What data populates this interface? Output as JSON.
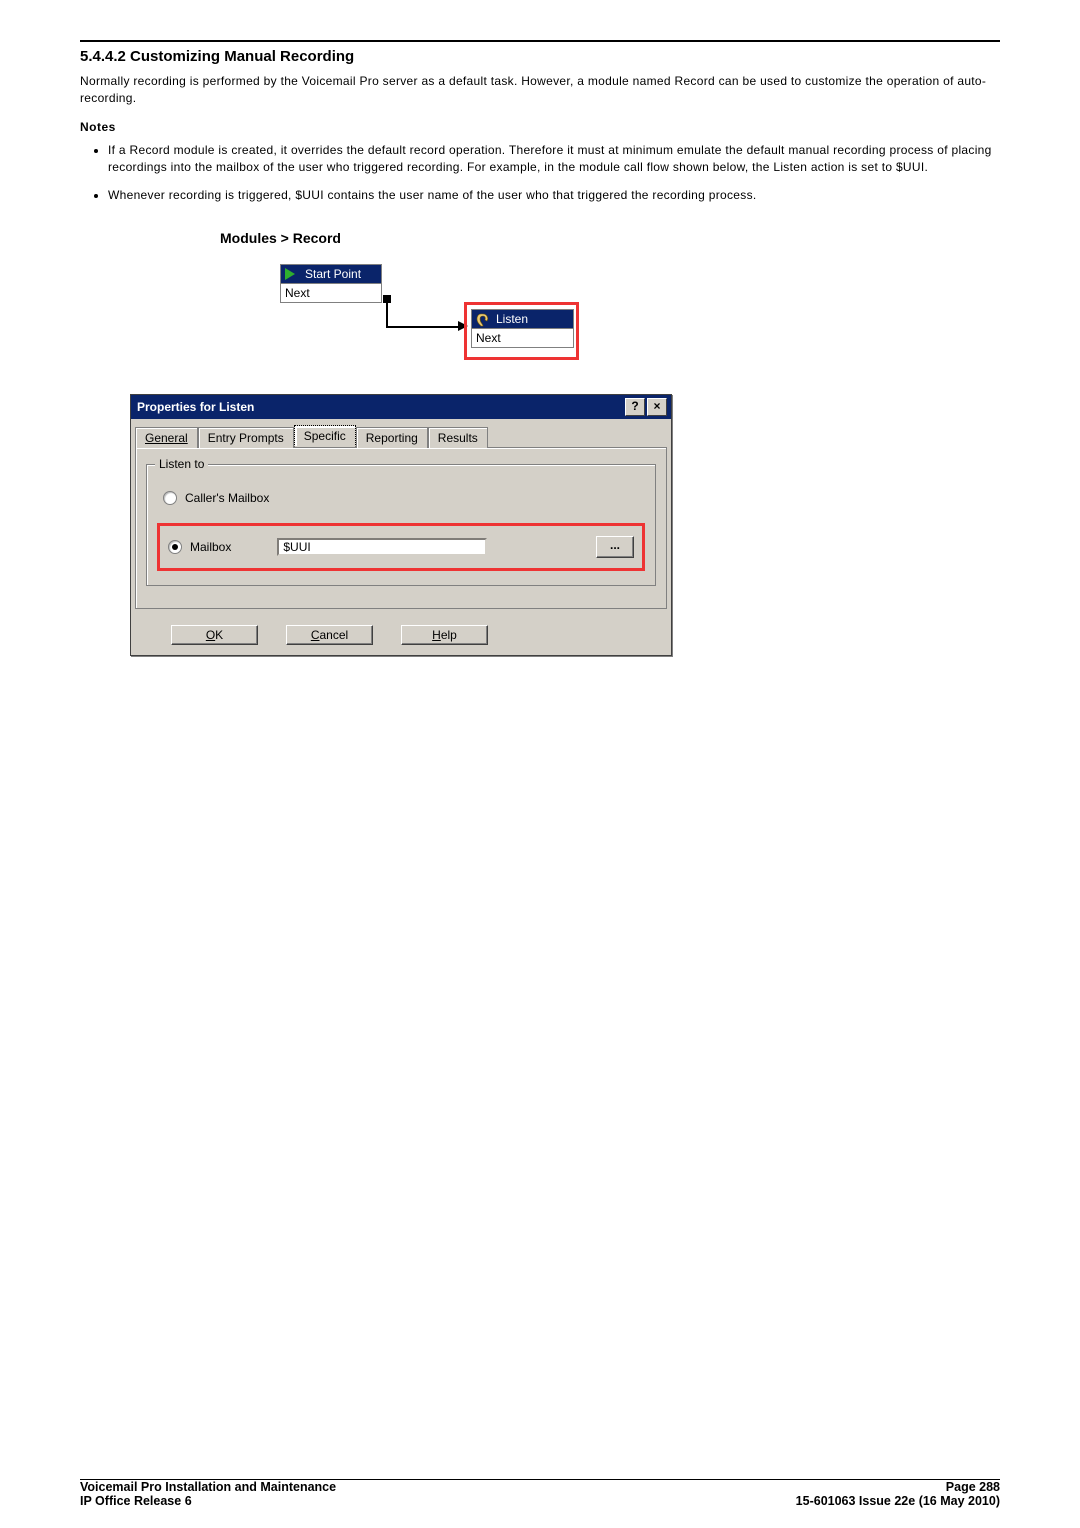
{
  "heading": "5.4.4.2 Customizing Manual Recording",
  "intro": "Normally recording is performed by the Voicemail Pro server as a default task. However, a module named Record can be used to customize the operation of auto-recording.",
  "notes_label": "Notes",
  "notes": [
    "If a Record module is created, it overrides the default record operation. Therefore it must at minimum emulate the default manual recording process of placing recordings into the mailbox of the user who triggered recording. For example, in the module call flow shown below, the Listen action is set to $UUI.",
    "Whenever recording is triggered, $UUI contains the user name of the user who that triggered the recording process."
  ],
  "breadcrumb": "Modules > Record",
  "flow": {
    "start_title": "Start Point",
    "start_sub": "Next",
    "listen_title": "Listen",
    "listen_sub": "Next"
  },
  "dialog": {
    "title": "Properties for Listen",
    "help_btn": "?",
    "close_btn": "×",
    "tabs": {
      "general": "General",
      "entry": "Entry Prompts",
      "specific": "Specific",
      "reporting": "Reporting",
      "results": "Results"
    },
    "group_legend": "Listen to",
    "radio_callers": "Caller's Mailbox",
    "radio_mailbox": "Mailbox",
    "mailbox_value": "$UUI",
    "browse_btn": "...",
    "ok": "OK",
    "cancel": "Cancel",
    "help": "Help"
  },
  "footer": {
    "left1": "Voicemail Pro Installation and Maintenance",
    "left2": "IP Office Release 6",
    "right1": "Page 288",
    "right2": "15-601063 Issue 22e (16 May 2010)"
  }
}
